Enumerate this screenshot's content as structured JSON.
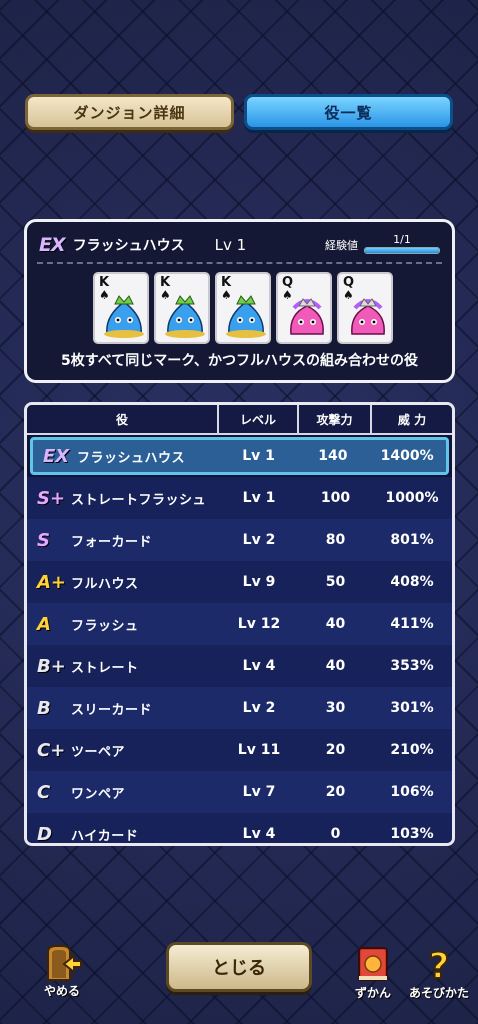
{
  "tabs": {
    "dungeon": "ダンジョン詳細",
    "hands": "役一覧"
  },
  "detail": {
    "rank": "EX",
    "name": "フラッシュハウス",
    "level": "Lv 1",
    "exp_label": "経験値",
    "exp_text": "1/1",
    "exp_fraction": 1.0,
    "description": "5枚すべて同じマーク、かつフルハウスの組み合わせの役",
    "cards": [
      {
        "rank": "K",
        "suit": "♠",
        "monster": "blue-slime-king"
      },
      {
        "rank": "K",
        "suit": "♠",
        "monster": "blue-slime-king"
      },
      {
        "rank": "K",
        "suit": "♠",
        "monster": "blue-slime-king"
      },
      {
        "rank": "Q",
        "suit": "♠",
        "monster": "pink-slime-queen"
      },
      {
        "rank": "Q",
        "suit": "♠",
        "monster": "pink-slime-queen"
      }
    ]
  },
  "table": {
    "headers": [
      "役",
      "レベル",
      "攻撃力",
      "威 力"
    ],
    "rows": [
      {
        "rank": "EX",
        "rank_color": "#d9b4ff",
        "name": "フラッシュハウス",
        "level": "Lv 1",
        "attack": "140",
        "power": "1400%"
      },
      {
        "rank": "S+",
        "rank_color": "#e6a8ff",
        "name": "ストレートフラッシュ",
        "level": "Lv 1",
        "attack": "100",
        "power": "1000%"
      },
      {
        "rank": "S",
        "rank_color": "#e6a8ff",
        "name": "フォーカード",
        "level": "Lv 2",
        "attack": "80",
        "power": "801%"
      },
      {
        "rank": "A+",
        "rank_color": "#ffd23a",
        "name": "フルハウス",
        "level": "Lv 9",
        "attack": "50",
        "power": "408%"
      },
      {
        "rank": "A",
        "rank_color": "#ffd23a",
        "name": "フラッシュ",
        "level": "Lv 12",
        "attack": "40",
        "power": "411%"
      },
      {
        "rank": "B+",
        "rank_color": "#e8e8f0",
        "name": "ストレート",
        "level": "Lv 4",
        "attack": "40",
        "power": "353%"
      },
      {
        "rank": "B",
        "rank_color": "#e8e8f0",
        "name": "スリーカード",
        "level": "Lv 2",
        "attack": "30",
        "power": "301%"
      },
      {
        "rank": "C+",
        "rank_color": "#e8e8f0",
        "name": "ツーペア",
        "level": "Lv 11",
        "attack": "20",
        "power": "210%"
      },
      {
        "rank": "C",
        "rank_color": "#e8e8f0",
        "name": "ワンペア",
        "level": "Lv 7",
        "attack": "20",
        "power": "106%"
      },
      {
        "rank": "D",
        "rank_color": "#e8e8f0",
        "name": "ハイカード",
        "level": "Lv 4",
        "attack": "0",
        "power": "103%"
      }
    ]
  },
  "bottom": {
    "quit_label": "やめる",
    "close_label": "とじる",
    "zukan_label": "ずかん",
    "help_label": "あそびかた"
  }
}
